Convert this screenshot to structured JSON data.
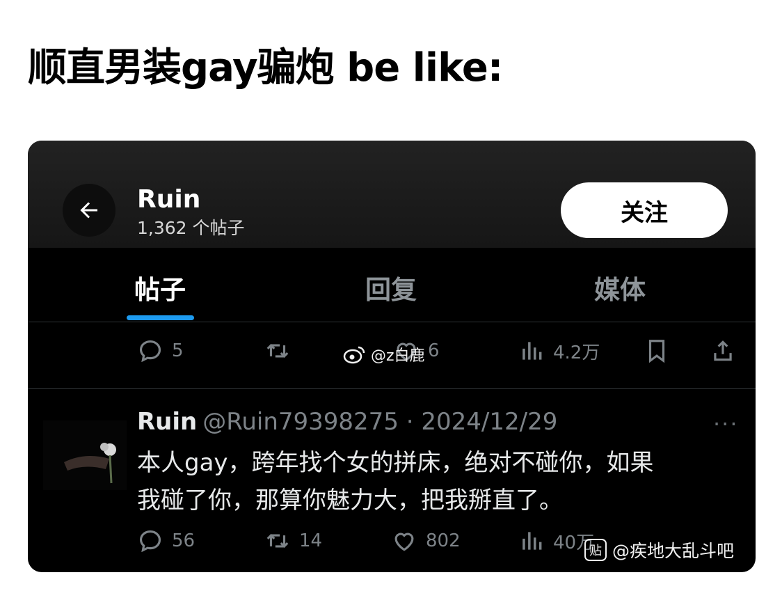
{
  "caption": "顺直男装gay骗炮 be like:",
  "header": {
    "name": "Ruin",
    "post_count": "1,362 个帖子",
    "follow_label": "关注"
  },
  "tabs": [
    {
      "label": "帖子",
      "active": true
    },
    {
      "label": "回复",
      "active": false
    },
    {
      "label": "媒体",
      "active": false
    }
  ],
  "prev_tweet_actions": {
    "reply_count": "5",
    "like_count": "6",
    "view_count": "4.2万"
  },
  "tweet": {
    "name": "Ruin",
    "handle_date": "@Ruin79398275 · 2024/12/29",
    "more": "···",
    "text_line1": "本人gay，跨年找个女的拼床，绝对不碰你，如果",
    "text_line2": "我碰了你，那算你魅力大，把我掰直了。",
    "reply_count": "56",
    "retweet_count": "14",
    "like_count": "802",
    "view_count": "40万"
  },
  "watermarks": {
    "weibo": "@z白鹿",
    "tieba": "@疾地大乱斗吧",
    "tieba_icon_text": "贴"
  },
  "colors": {
    "accent": "#1d9bf0",
    "background": "#000000",
    "muted": "#7d8388"
  }
}
